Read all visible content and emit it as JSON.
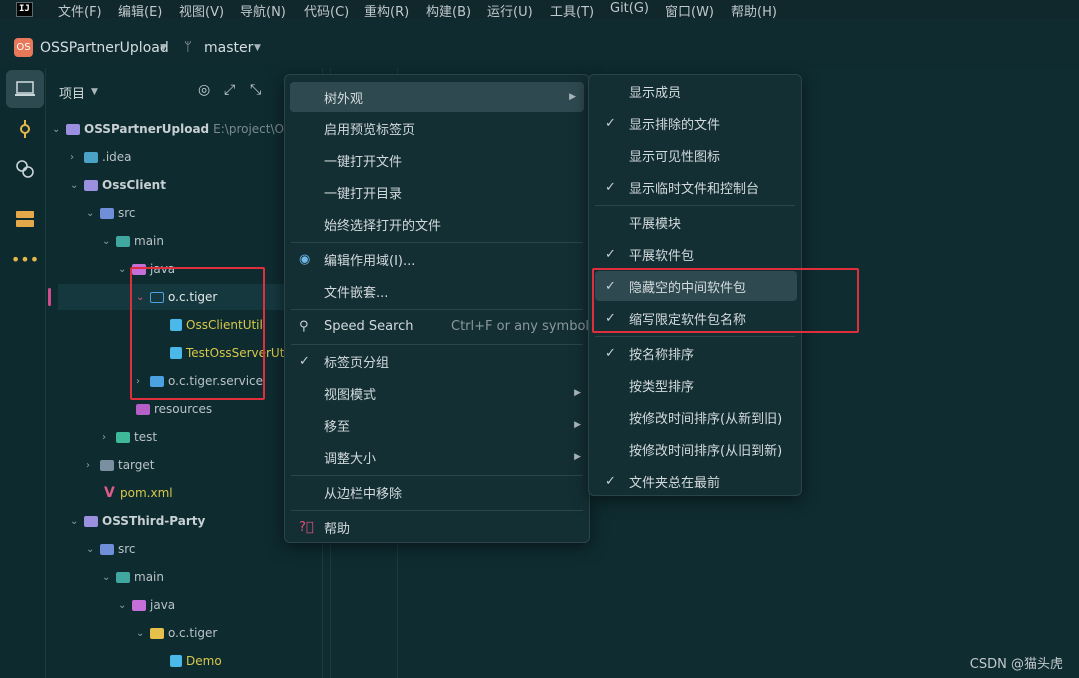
{
  "menubar": {
    "logo": "IJ",
    "items": [
      "文件(F)",
      "编辑(E)",
      "视图(V)",
      "导航(N)",
      "代码(C)",
      "重构(R)",
      "构建(B)",
      "运行(U)",
      "工具(T)",
      "Git(G)",
      "窗口(W)",
      "帮助(H)"
    ]
  },
  "header": {
    "project_badge": "OS",
    "project_name": "OSSPartnerUpload",
    "branch": "master"
  },
  "panel": {
    "title": "项目"
  },
  "tree": [
    {
      "label": "OSSPartnerUpload",
      "path": "E:\\project\\OS",
      "color": "#9b8fe0"
    },
    {
      "label": ".idea",
      "color": "#4aa3c7"
    },
    {
      "label": "OssClient",
      "color": "#9b8fe0"
    },
    {
      "label": "src",
      "color": "#6f8fd8"
    },
    {
      "label": "main",
      "color": "#3fa7a0"
    },
    {
      "label": "java",
      "color": "#c66fd8"
    },
    {
      "label": "o.c.tiger",
      "color": "#4aa3e0"
    },
    {
      "label": "OssClientUtil",
      "color": "#4ab8e8"
    },
    {
      "label": "TestOssServerUti",
      "color": "#4ab8e8"
    },
    {
      "label": "o.c.tiger.service",
      "color": "#4aa3e0"
    },
    {
      "label": "resources",
      "color": "#b55fc9"
    },
    {
      "label": "test",
      "color": "#3fb89a"
    },
    {
      "label": "target",
      "color": "#7a8fa0"
    },
    {
      "label": "pom.xml",
      "color": "#e05a8a"
    },
    {
      "label": "OSSThird-Party",
      "color": "#9b8fe0"
    },
    {
      "label": "src",
      "color": "#6f8fd8"
    },
    {
      "label": "main",
      "color": "#3fa7a0"
    },
    {
      "label": "java",
      "color": "#c66fd8"
    },
    {
      "label": "o.c.tiger",
      "color": "#e6c04a"
    },
    {
      "label": "Demo",
      "color": "#4ab8e8"
    }
  ],
  "context_menu": {
    "items": [
      {
        "label": "树外观",
        "submenu": true
      },
      {
        "label": "启用预览标签页"
      },
      {
        "label": "一键打开文件"
      },
      {
        "label": "一键打开目录"
      },
      {
        "label": "始终选择打开的文件"
      },
      {
        "label": "编辑作用域(I)..."
      },
      {
        "label": "文件嵌套..."
      },
      {
        "label": "Speed Search",
        "hint": "Ctrl+F or any symbol"
      },
      {
        "label": "标签页分组"
      },
      {
        "label": "视图模式",
        "submenu": true
      },
      {
        "label": "移至",
        "submenu": true
      },
      {
        "label": "调整大小",
        "submenu": true
      },
      {
        "label": "从边栏中移除"
      },
      {
        "label": "帮助"
      }
    ]
  },
  "submenu": {
    "items": [
      {
        "label": "显示成员",
        "checked": false
      },
      {
        "label": "显示排除的文件",
        "checked": true
      },
      {
        "label": "显示可见性图标",
        "checked": false
      },
      {
        "label": "显示临时文件和控制台",
        "checked": true
      },
      {
        "label": "平展模块",
        "checked": false
      },
      {
        "label": "平展软件包",
        "checked": true
      },
      {
        "label": "隐藏空的中间软件包",
        "checked": true
      },
      {
        "label": "缩写限定软件包名称",
        "checked": true
      },
      {
        "label": "按名称排序",
        "checked": true
      },
      {
        "label": "按类型排序",
        "checked": false
      },
      {
        "label": "按修改时间排序(从新到旧)",
        "checked": false
      },
      {
        "label": "按修改时间排序(从旧到新)",
        "checked": false
      },
      {
        "label": "文件夹总在最前",
        "checked": true
      }
    ],
    "check_glyph": "✓"
  },
  "watermark": "CSDN @猫头虎",
  "colors": {
    "background": "#0e2b30",
    "highlight": "#2e4a50",
    "annotation_red": "#e02f3c"
  }
}
